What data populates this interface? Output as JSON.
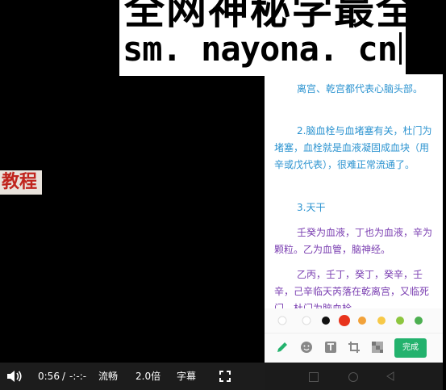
{
  "watermark": {
    "line1": "全网神秘学最全",
    "line2": "sm. nayona. cn"
  },
  "left_caption": "教程",
  "content": {
    "p1": "离宫、乾宫都代表心脑头部。",
    "p2": "2.脑血栓与血堵塞有关，杜门为堵塞，血栓就是血液凝固成血块（用辛或戊代表），很难正常流通了。",
    "p3": "3.天干",
    "p4": "壬癸为血液，丁也为血液，辛为颗粒。乙为血管，脑神经。",
    "p5": "乙丙，壬丁，癸丁，癸辛，壬辛，己辛临天芮落在乾离宫，又临死门、杜门为脑血栓。"
  },
  "palette": {
    "colors": [
      "#ffffff",
      "#ffffff",
      "#111111",
      "#e8341c",
      "#f2a23a",
      "#f7c948",
      "#8dc63f",
      "#4caf50"
    ]
  },
  "editor_toolbar": {
    "done_label": "完成",
    "tools": [
      "pen-icon",
      "emoji-icon",
      "text-icon",
      "crop-icon",
      "mosaic-icon"
    ]
  },
  "player": {
    "time_current": "0:56",
    "time_separator": "/",
    "time_total": "-:-:-",
    "quality": "流畅",
    "speed": "2.0倍",
    "subtitles": "字幕",
    "accent": "#2b93d0"
  }
}
